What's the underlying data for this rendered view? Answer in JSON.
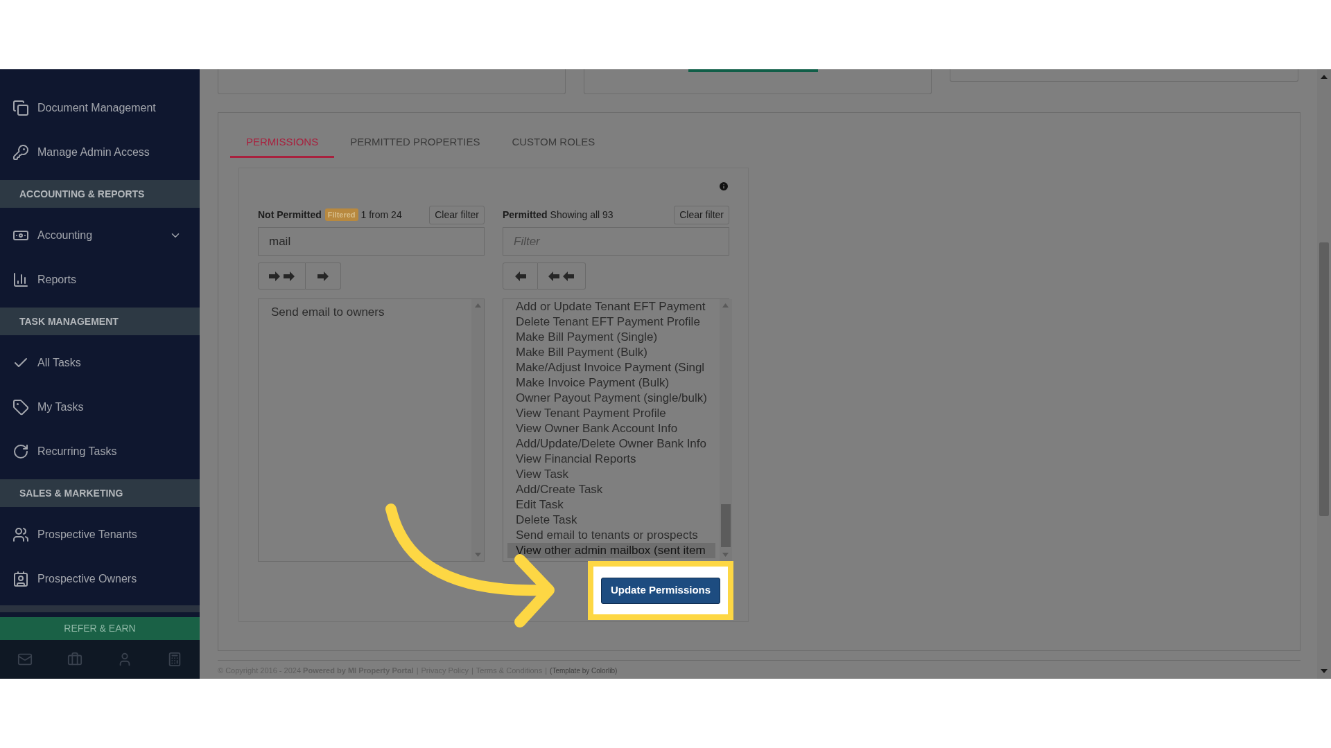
{
  "sidebar": {
    "items": [
      {
        "kind": "item",
        "label": "Document Management"
      },
      {
        "kind": "item",
        "label": "Manage Admin Access"
      },
      {
        "kind": "header",
        "label": "ACCOUNTING & REPORTS"
      },
      {
        "kind": "group",
        "label": "Accounting"
      },
      {
        "kind": "item",
        "label": "Reports"
      },
      {
        "kind": "header",
        "label": "TASK MANAGEMENT"
      },
      {
        "kind": "item",
        "label": "All Tasks"
      },
      {
        "kind": "item",
        "label": "My Tasks"
      },
      {
        "kind": "item",
        "label": "Recurring Tasks"
      },
      {
        "kind": "header",
        "label": "SALES & MARKETING"
      },
      {
        "kind": "item",
        "label": "Prospective Tenants"
      },
      {
        "kind": "item",
        "label": "Prospective Owners"
      }
    ],
    "refer_button": "REFER & EARN"
  },
  "tabs": [
    {
      "label": "PERMISSIONS",
      "selected": true
    },
    {
      "label": "PERMITTED PROPERTIES",
      "selected": false
    },
    {
      "label": "CUSTOM ROLES",
      "selected": false
    }
  ],
  "not_permitted": {
    "title": "Not Permitted",
    "badge": "Filtered",
    "count": "1 from 24",
    "clear_button": "Clear filter",
    "filter": {
      "value": "mail"
    },
    "items": [
      {
        "label": "Send email to owners",
        "selected": false
      }
    ]
  },
  "permitted": {
    "title": "Permitted",
    "count": "Showing all 93",
    "clear_button": "Clear filter",
    "filter": {
      "placeholder": "Filter"
    },
    "items": [
      {
        "label": "Add or Update Tenant EFT Payment",
        "selected": false
      },
      {
        "label": "Delete Tenant EFT Payment Profile",
        "selected": false
      },
      {
        "label": "Make Bill Payment (Single)",
        "selected": false
      },
      {
        "label": "Make Bill Payment (Bulk)",
        "selected": false
      },
      {
        "label": "Make/Adjust Invoice Payment (Singl",
        "selected": false
      },
      {
        "label": "Make Invoice Payment (Bulk)",
        "selected": false
      },
      {
        "label": "Owner Payout Payment (single/bulk)",
        "selected": false
      },
      {
        "label": "View Tenant Payment Profile",
        "selected": false
      },
      {
        "label": "View Owner Bank Account Info",
        "selected": false
      },
      {
        "label": "Add/Update/Delete Owner Bank Info",
        "selected": false
      },
      {
        "label": "View Financial Reports",
        "selected": false
      },
      {
        "label": "View Task",
        "selected": false
      },
      {
        "label": "Add/Create Task",
        "selected": false
      },
      {
        "label": "Edit Task",
        "selected": false
      },
      {
        "label": "Delete Task",
        "selected": false
      },
      {
        "label": "Send email to tenants or prospects",
        "selected": false
      },
      {
        "label": "View other admin mailbox (sent item",
        "selected": true
      }
    ]
  },
  "update_button": "Update Permissions",
  "footer": {
    "copyright": "© Copyright 2016 - 2024 **Powered by MI Property Portal**",
    "separator": "|",
    "links": [
      "Privacy Policy",
      "Terms & Conditions"
    ],
    "template_note": "(Template by Colorlib)"
  }
}
